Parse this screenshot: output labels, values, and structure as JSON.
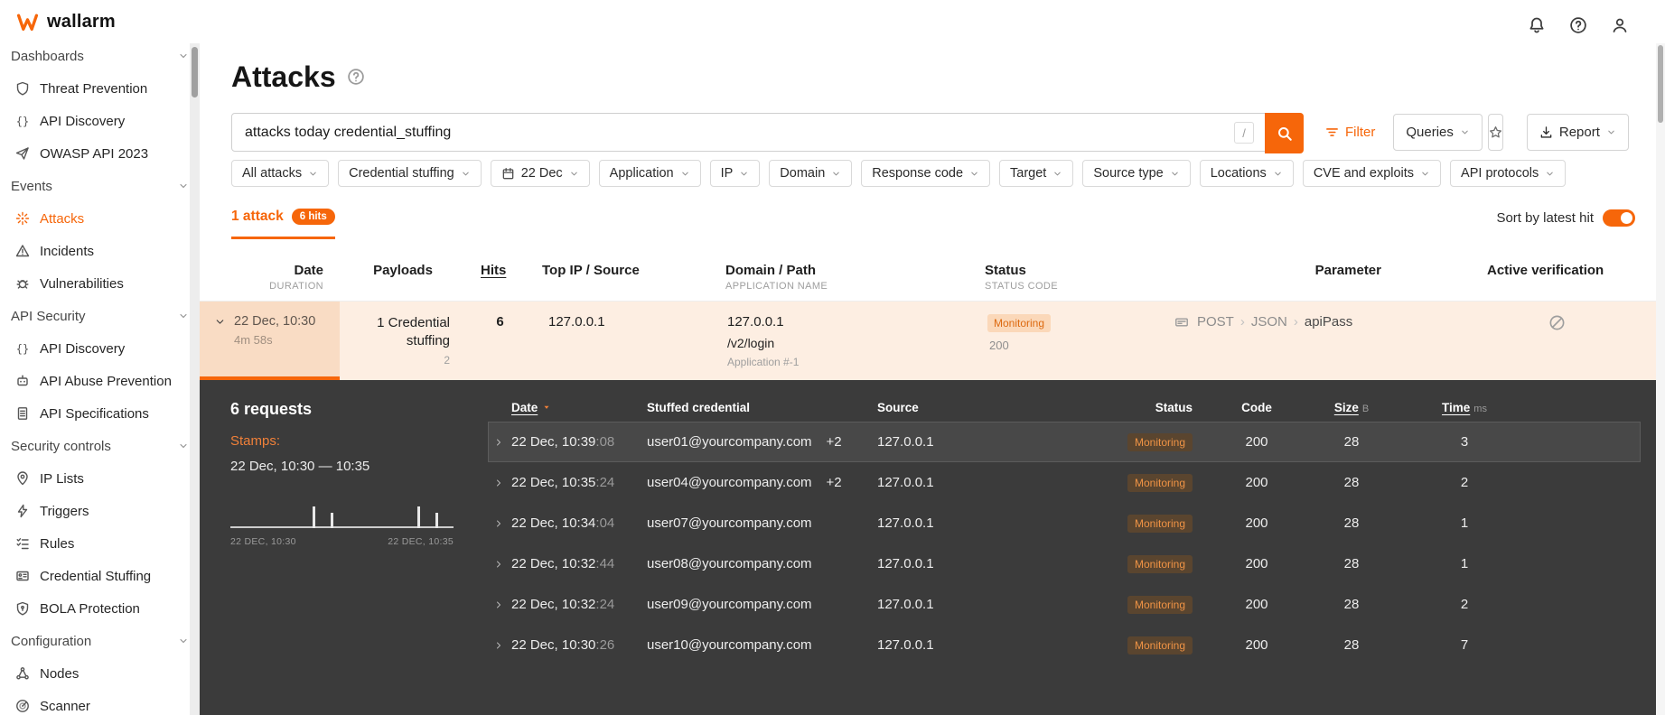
{
  "colors": {
    "accent": "#f6660a",
    "dark_panel": "#3b3b3b",
    "attack_row_bg": "#fdeee2",
    "monitoring_badge_bg": "#fbd8b9",
    "monitoring_badge_text": "#dd6a10"
  },
  "sidebar": {
    "logo": "wallarm",
    "items": [
      {
        "type": "section",
        "label": "Dashboards"
      },
      {
        "type": "item",
        "label": "Threat Prevention",
        "icon": "shield"
      },
      {
        "type": "item",
        "label": "API Discovery",
        "icon": "braces"
      },
      {
        "type": "item",
        "label": "OWASP API 2023",
        "icon": "send"
      },
      {
        "type": "section",
        "label": "Events"
      },
      {
        "type": "item",
        "label": "Attacks",
        "icon": "attack",
        "active": true
      },
      {
        "type": "item",
        "label": "Incidents",
        "icon": "warning"
      },
      {
        "type": "item",
        "label": "Vulnerabilities",
        "icon": "bug"
      },
      {
        "type": "section",
        "label": "API Security"
      },
      {
        "type": "item",
        "label": "API Discovery",
        "icon": "braces"
      },
      {
        "type": "item",
        "label": "API Abuse Prevention",
        "icon": "bot"
      },
      {
        "type": "item",
        "label": "API Specifications",
        "icon": "doc"
      },
      {
        "type": "section",
        "label": "Security controls"
      },
      {
        "type": "item",
        "label": "IP Lists",
        "icon": "pin"
      },
      {
        "type": "item",
        "label": "Triggers",
        "icon": "bolt"
      },
      {
        "type": "item",
        "label": "Rules",
        "icon": "rules"
      },
      {
        "type": "item",
        "label": "Credential Stuffing",
        "icon": "card"
      },
      {
        "type": "item",
        "label": "BOLA Protection",
        "icon": "shieldlock"
      },
      {
        "type": "section",
        "label": "Configuration"
      },
      {
        "type": "item",
        "label": "Nodes",
        "icon": "nodes"
      },
      {
        "type": "item",
        "label": "Scanner",
        "icon": "scanner"
      }
    ]
  },
  "topbar": {
    "icons": [
      {
        "icon": "bell"
      },
      {
        "icon": "help"
      },
      {
        "icon": "user"
      }
    ]
  },
  "page": {
    "title": "Attacks"
  },
  "search": {
    "value": "attacks today credential_stuffing",
    "shortcut": "/",
    "filter": "Filter",
    "queries": "Queries",
    "report": "Report"
  },
  "filters": [
    {
      "label": "All attacks"
    },
    {
      "label": "Credential stuffing"
    },
    {
      "label": "22 Dec",
      "icon": "calendar"
    },
    {
      "label": "Application"
    },
    {
      "label": "IP"
    },
    {
      "label": "Domain"
    },
    {
      "label": "Response code"
    },
    {
      "label": "Target"
    },
    {
      "label": "Source type"
    },
    {
      "label": "Locations"
    },
    {
      "label": "CVE and exploits"
    },
    {
      "label": "API protocols"
    }
  ],
  "results": {
    "tab": "1 attack",
    "hits_badge": "6 hits",
    "sort_label": "Sort by latest hit",
    "sort_on": true
  },
  "attacks_table": {
    "columns": [
      {
        "label": "Date",
        "sub": "DURATION"
      },
      {
        "label": "Payloads",
        "sub": ""
      },
      {
        "label": "Hits",
        "sub": "",
        "sorted": true
      },
      {
        "label": "Top IP / Source",
        "sub": ""
      },
      {
        "label": "Domain / Path",
        "sub": "APPLICATION NAME"
      },
      {
        "label": "Status",
        "sub": "STATUS CODE"
      },
      {
        "label": "Parameter",
        "sub": ""
      },
      {
        "label": "Active verification",
        "sub": ""
      }
    ],
    "row": {
      "date": "22 Dec, 10:30",
      "duration": "4m 58s",
      "payload": "1 Credential stuffing",
      "payload_count": "2",
      "hits": "6",
      "top_ip": "127.0.0.1",
      "domain": "127.0.0.1",
      "path": "/v2/login",
      "application": "Application #-1",
      "status": "Monitoring",
      "status_code": "200",
      "parameter": [
        "POST",
        "JSON",
        "apiPass"
      ]
    }
  },
  "details": {
    "requests_count": "6 requests",
    "stamps_label": "Stamps:",
    "range": "22 Dec, 10:30 — 10:35",
    "chart": {
      "type": "bar",
      "start_label": "22 DEC, 10:30",
      "end_label": "22 DEC, 10:35",
      "bars": [
        {
          "x": 0.37,
          "h": 1
        },
        {
          "x": 0.45,
          "h": 0.7
        },
        {
          "x": 0.84,
          "h": 1
        },
        {
          "x": 0.92,
          "h": 0.7
        }
      ]
    },
    "table": {
      "headers": {
        "date": "Date",
        "credential": "Stuffed credential",
        "source": "Source",
        "status": "Status",
        "code": "Code",
        "size": "Size",
        "size_unit": "B",
        "time": "Time",
        "time_unit": "ms"
      },
      "rows": [
        {
          "date": "22 Dec, 10:39",
          "sec": ":08",
          "credential": "user01@yourcompany.com",
          "extra": "+2",
          "source": "127.0.0.1",
          "status": "Monitoring",
          "code": "200",
          "size": "28",
          "time": "3",
          "highlight": true
        },
        {
          "date": "22 Dec, 10:35",
          "sec": ":24",
          "credential": "user04@yourcompany.com",
          "extra": "+2",
          "source": "127.0.0.1",
          "status": "Monitoring",
          "code": "200",
          "size": "28",
          "time": "2"
        },
        {
          "date": "22 Dec, 10:34",
          "sec": ":04",
          "credential": "user07@yourcompany.com",
          "source": "127.0.0.1",
          "status": "Monitoring",
          "code": "200",
          "size": "28",
          "time": "1"
        },
        {
          "date": "22 Dec, 10:32",
          "sec": ":44",
          "credential": "user08@yourcompany.com",
          "source": "127.0.0.1",
          "status": "Monitoring",
          "code": "200",
          "size": "28",
          "time": "1"
        },
        {
          "date": "22 Dec, 10:32",
          "sec": ":24",
          "credential": "user09@yourcompany.com",
          "source": "127.0.0.1",
          "status": "Monitoring",
          "code": "200",
          "size": "28",
          "time": "2"
        },
        {
          "date": "22 Dec, 10:30",
          "sec": ":26",
          "credential": "user10@yourcompany.com",
          "source": "127.0.0.1",
          "status": "Monitoring",
          "code": "200",
          "size": "28",
          "time": "7"
        }
      ]
    }
  }
}
